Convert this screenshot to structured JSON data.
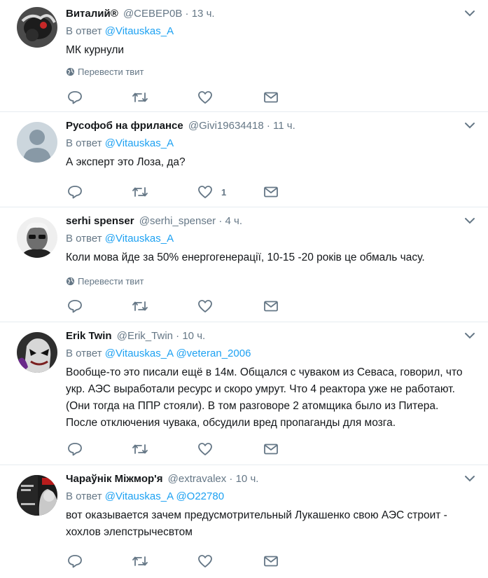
{
  "reply_prefix": "В ответ",
  "translate_label": "Перевести твит",
  "colors": {
    "accent": "#1da1f2",
    "secondary": "#657786",
    "text": "#14171a",
    "divider": "#e6ecf0"
  },
  "icons": {
    "reply": "reply-icon",
    "retweet": "retweet-icon",
    "like": "heart-icon",
    "dm": "envelope-icon",
    "caret": "chevron-down-icon",
    "translate": "globe-icon"
  },
  "tweets": [
    {
      "name": "Виталий®",
      "handle": "@СЕВЕР0В",
      "dot": "·",
      "time": "13 ч.",
      "mentions": [
        "@Vitauskas_A"
      ],
      "text": "МК курнули",
      "like_count": ""
    },
    {
      "name": "Русофоб на фрилансе",
      "handle": "@Givi19634418",
      "dot": "·",
      "time": "11 ч.",
      "mentions": [
        "@Vitauskas_A"
      ],
      "text": "А эксперт это Лоза, да?",
      "like_count": "1"
    },
    {
      "name": "serhi spenser",
      "handle": "@serhi_spenser",
      "dot": "·",
      "time": "4 ч.",
      "mentions": [
        "@Vitauskas_A"
      ],
      "text": "Коли мова йде за 50% енергогенерації, 10-15 -20 років це обмаль часу.",
      "like_count": ""
    },
    {
      "name": "Erik Twin",
      "handle": "@Erik_Twin",
      "dot": "·",
      "time": "10 ч.",
      "mentions": [
        "@Vitauskas_A",
        "@veteran_2006"
      ],
      "text": "Вообще-то это писали ещё в 14м. Общался с чуваком из Севаса, говорил, что укр. АЭС выработали ресурс и скоро умрут. Что 4 реактора уже не работают. (Они тогда на ППР стояли). В том разговоре 2 атомщика было из Питера. После отключения чувака, обсудили вред пропаганды для мозга.",
      "like_count": ""
    },
    {
      "name": "Чараўнік Міжмор'я",
      "handle": "@extravalex",
      "dot": "·",
      "time": "10 ч.",
      "mentions": [
        "@Vitauskas_A",
        "@O22780"
      ],
      "text": "вот оказывается зачем предусмотрительный Лукашенко свою АЭС строит - хохлов элепстрычесвтом",
      "like_count": ""
    }
  ]
}
